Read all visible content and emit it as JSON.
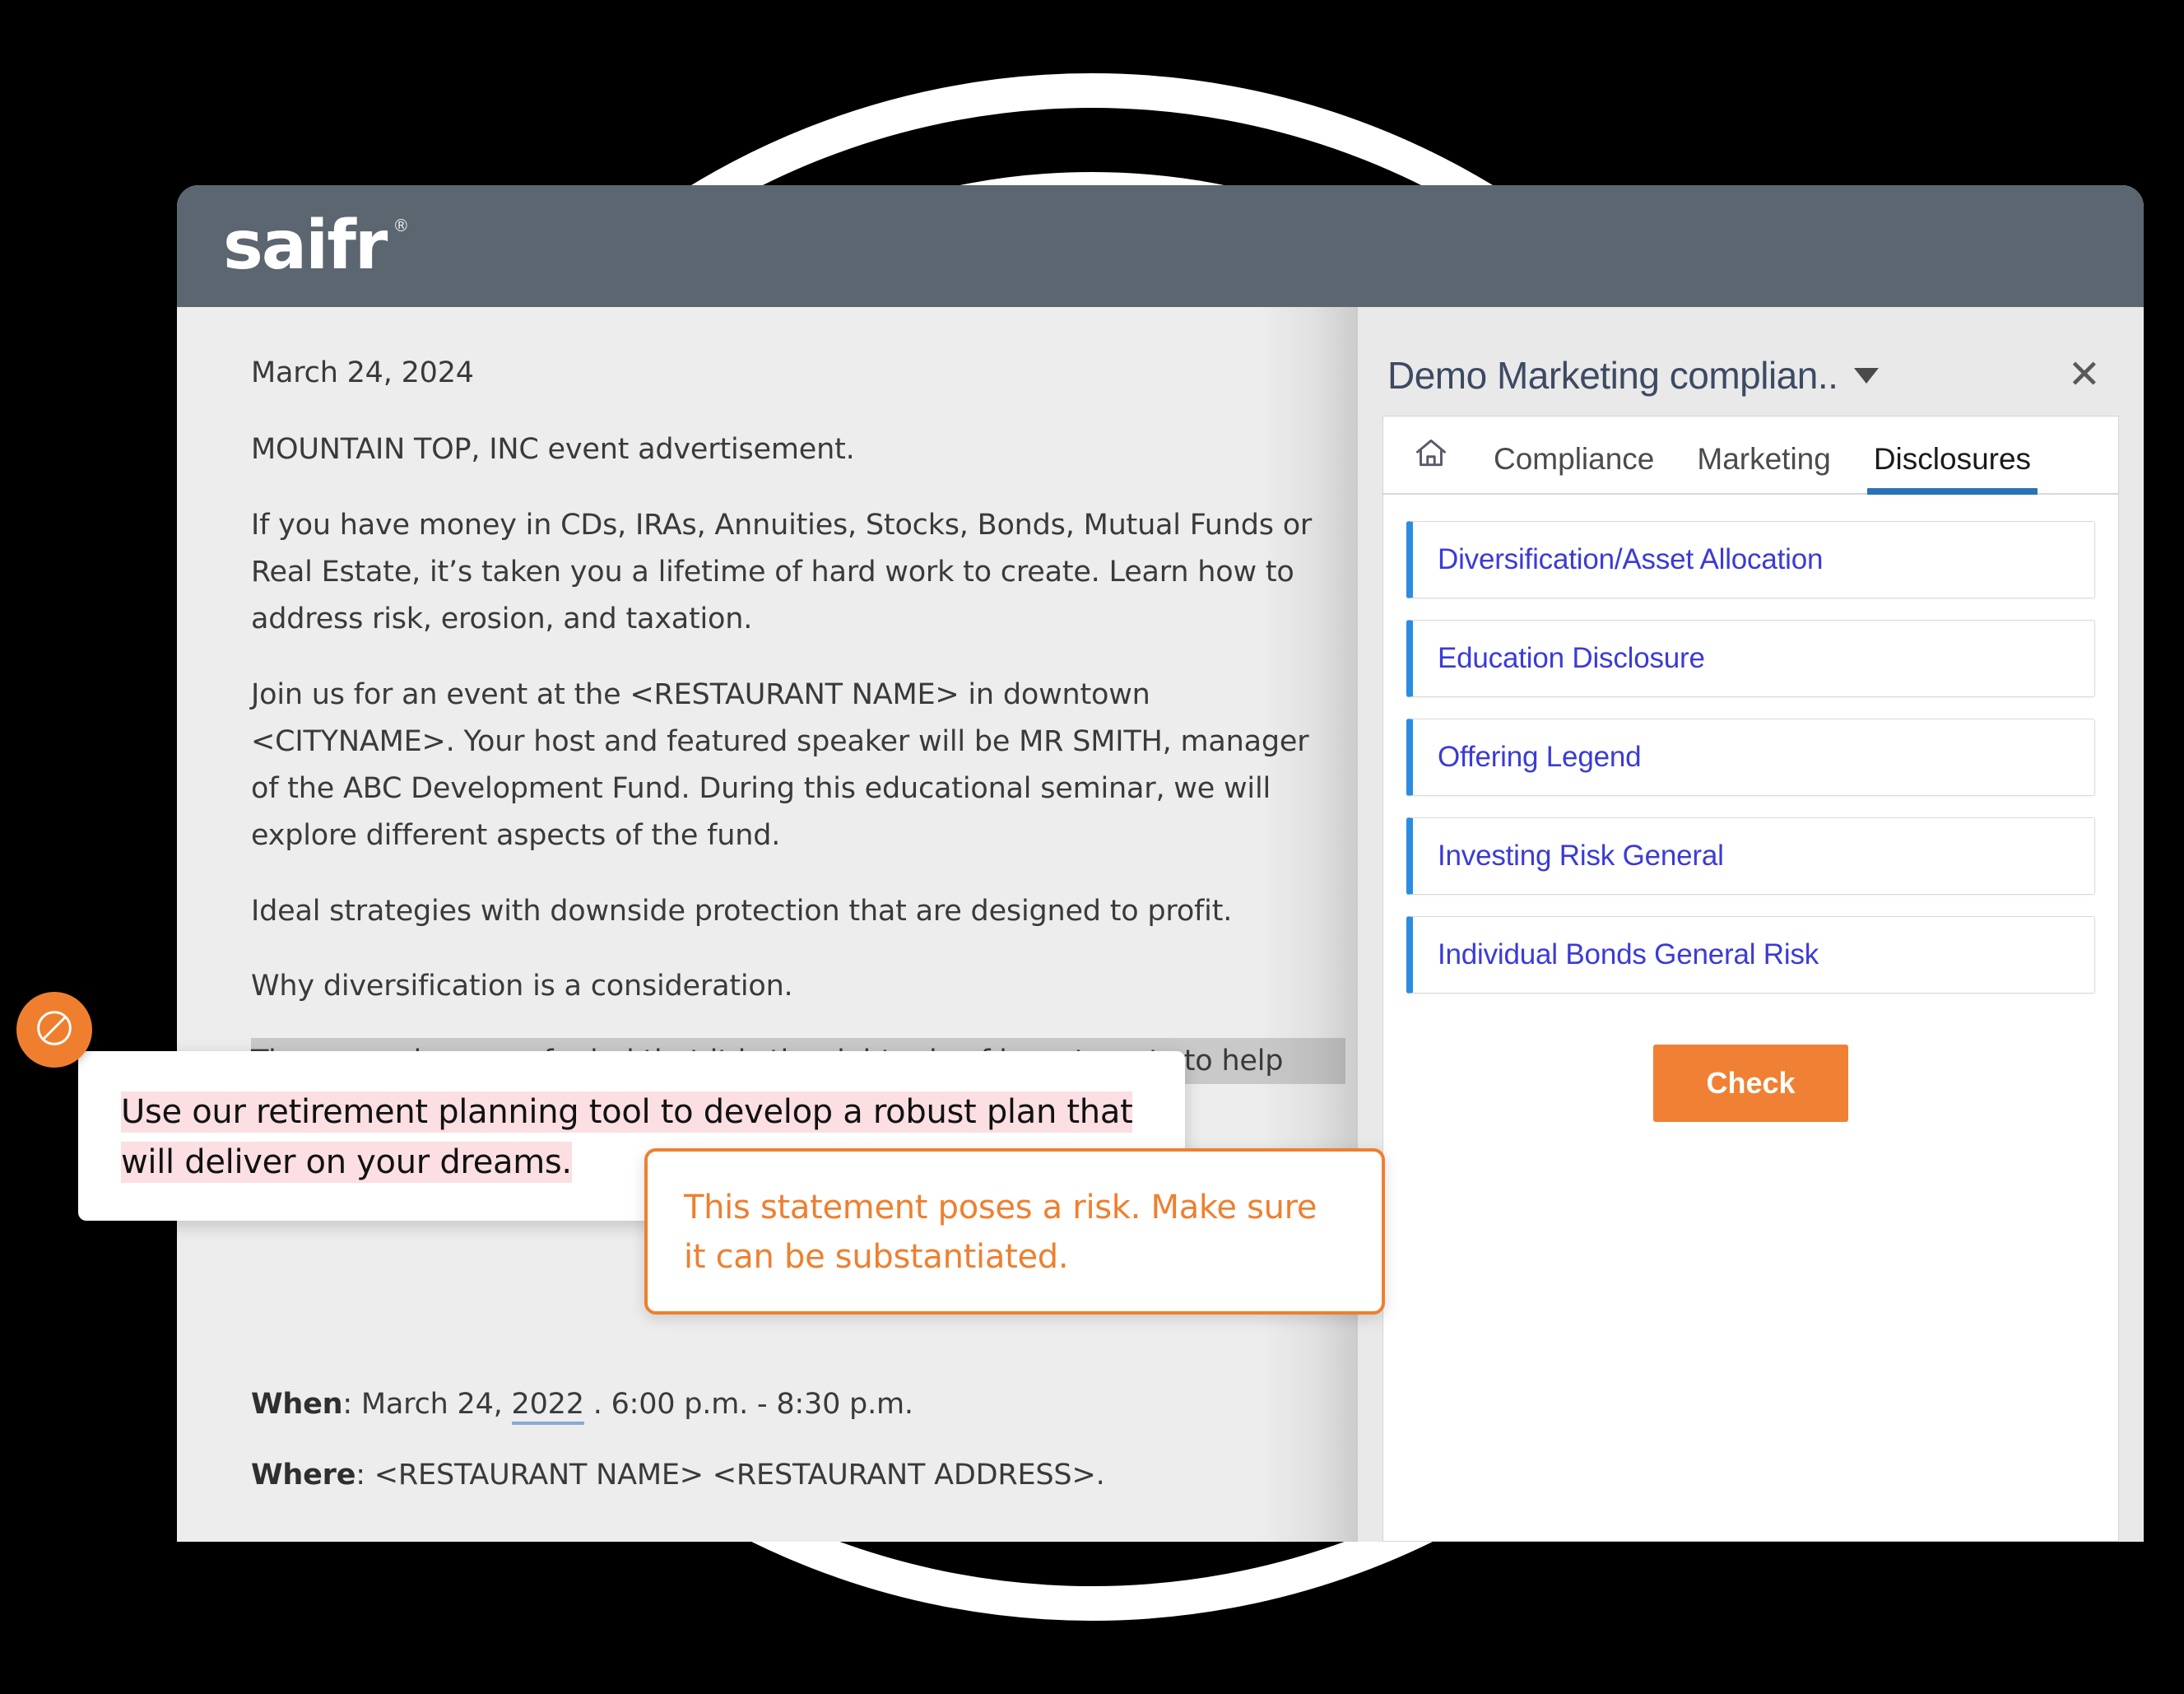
{
  "app": {
    "logo_text": "saifr",
    "logo_registered": "®"
  },
  "document": {
    "date": "March 24, 2024",
    "subject": "MOUNTAIN TOP, INC event advertisement.",
    "paragraphs": [
      "If you have money in CDs, IRAs, Annuities, Stocks, Bonds, Mutual Funds or Real Estate, it’s taken you a lifetime of hard work to create.  Learn how to address risk, erosion, and taxation.",
      "Join us for an event at the <RESTAURANT NAME> in downtown <CITYNAME>.  Your host and featured speaker will be MR SMITH, manager of the ABC Development Fund.  During this educational seminar, we will explore different aspects of the fund.",
      "Ideal strategies with downside protection that are designed to profit.",
      "Why diversification is a consideration."
    ],
    "selected_line": "The general peace of mind that it is the right mix of investments to help",
    "when_label": "When",
    "when_value_pre": ": March 24, ",
    "when_year": "2022",
    "when_value_post": " . 6:00 p.m. - 8:30 p.m.",
    "where_label": "Where",
    "where_value": ": <RESTAURANT NAME> <RESTAURANT ADDRESS>."
  },
  "annotation": {
    "badge_icon": "prohibited-icon",
    "highlighted_text": "Use our retirement planning tool to develop a robust plan that will deliver on your dreams.",
    "tooltip_text": "This statement poses a risk. Make sure it can be substantiated.",
    "accent_color": "#ef7f2f",
    "highlight_color": "#fbdfe2"
  },
  "panel": {
    "title": "Demo Marketing complian..",
    "close_label": "✕",
    "tabs": [
      {
        "label": "Compliance",
        "active": false
      },
      {
        "label": "Marketing",
        "active": false
      },
      {
        "label": "Disclosures",
        "active": true
      }
    ],
    "home_icon": "home-icon",
    "disclosures": [
      {
        "label": "Diversification/Asset Allocation"
      },
      {
        "label": "Education Disclosure"
      },
      {
        "label": "Offering Legend"
      },
      {
        "label": "Investing Risk General"
      },
      {
        "label": "Individual Bonds General Risk"
      }
    ],
    "check_button": "Check",
    "accent_color": "#f08134",
    "item_border_color": "#2a8de0",
    "item_text_color": "#3b3bd6"
  }
}
